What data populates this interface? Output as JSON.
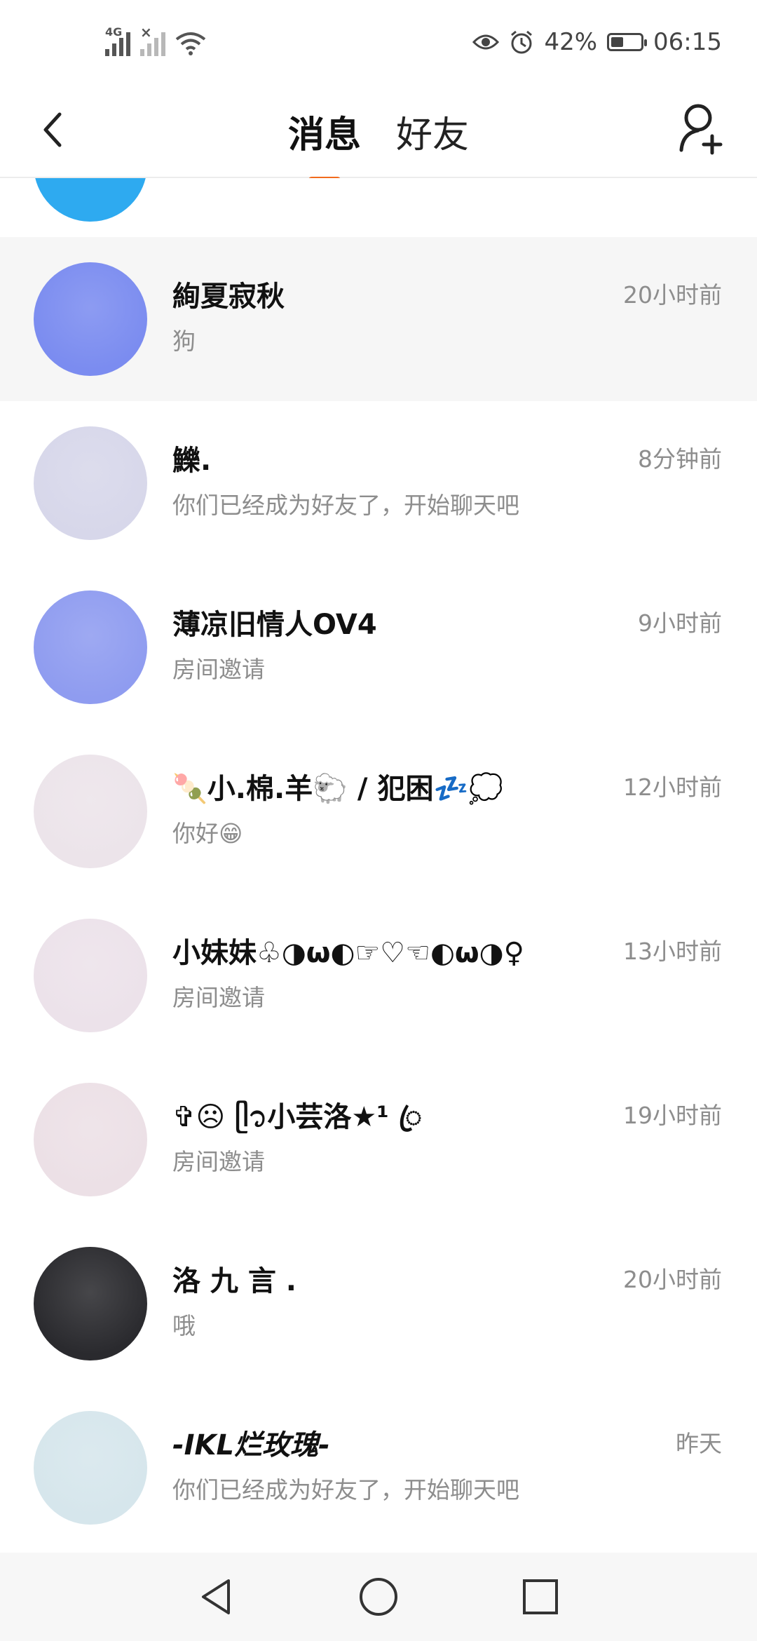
{
  "status_bar": {
    "network_tag": "4G",
    "battery": "42%",
    "battery_level": 0.42,
    "time": "06:15",
    "icons": [
      "signal-icon",
      "signal-no-sim-icon",
      "wifi-icon",
      "eye-icon",
      "alarm-icon",
      "battery-icon"
    ]
  },
  "header": {
    "tabs": [
      {
        "label": "消息",
        "active": true
      },
      {
        "label": "好友",
        "active": false
      }
    ],
    "accent_color": "#f26b1d",
    "icons": [
      "back-icon",
      "add-friend-icon"
    ]
  },
  "chats": [
    {
      "name": "絢夏寂秋",
      "preview": "狗",
      "time": "20小时前",
      "avatar_color": "#7b8cf0",
      "highlight": true,
      "italic": false
    },
    {
      "name": "鱳.",
      "preview": "你们已经成为好友了，开始聊天吧",
      "time": "8分钟前",
      "avatar_color": "#d7d7ea",
      "highlight": false,
      "italic": false
    },
    {
      "name": "薄凉旧情人OV4",
      "preview": "房间邀请",
      "time": "9小时前",
      "avatar_color": "#8f9cf0",
      "highlight": false,
      "italic": false
    },
    {
      "name": "🍡小.棉.羊🐑 / 犯困💤💭",
      "preview": "你好😁",
      "time": "12小时前",
      "avatar_color": "#ece4ea",
      "highlight": false,
      "italic": false
    },
    {
      "name": "小妹妹♧◑ω◐☞♡☜◐ω◑♀",
      "preview": "房间邀请",
      "time": "13小时前",
      "avatar_color": "#ece2ea",
      "highlight": false,
      "italic": false
    },
    {
      "name": "✞☹︎ ᥫ᭡小芸洛★¹ ꦿ",
      "preview": "房间邀请",
      "time": "19小时前",
      "avatar_color": "#ece0e6",
      "highlight": false,
      "italic": false
    },
    {
      "name": "洛 九 言 .",
      "preview": "哦",
      "time": "20小时前",
      "avatar_color": "#2a2a2e",
      "highlight": false,
      "italic": false
    },
    {
      "name": "-IKL烂玫瑰-",
      "preview": "你们已经成为好友了，开始聊天吧",
      "time": "昨天",
      "avatar_color": "#d6e6ec",
      "highlight": false,
      "italic": true
    }
  ],
  "partial_avatar_color": "#2eaaf0",
  "nav": {
    "icons": [
      "back-triangle-icon",
      "home-circle-icon",
      "recents-square-icon"
    ]
  }
}
